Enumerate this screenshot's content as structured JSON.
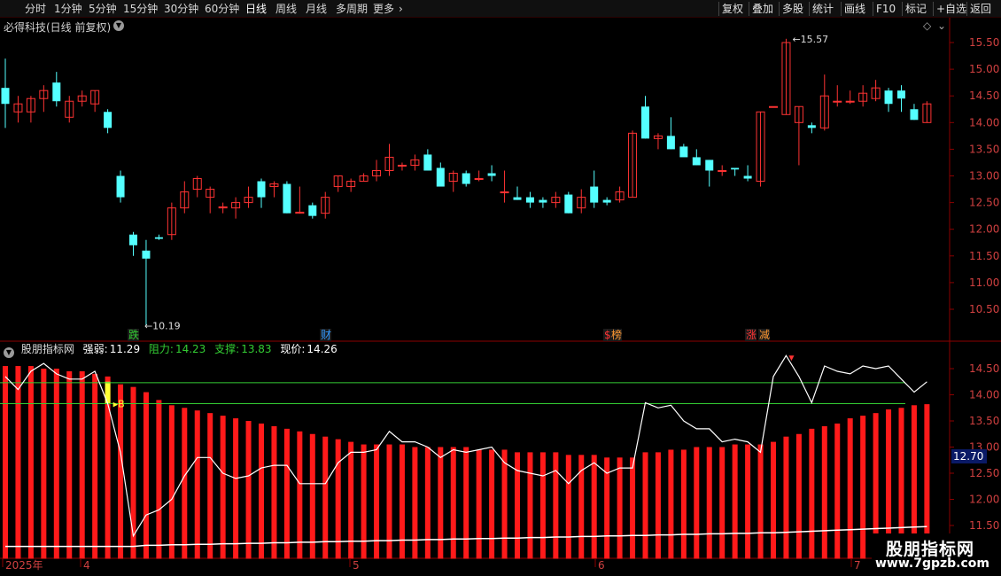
{
  "toolbar": {
    "left_items": [
      "分时",
      "1分钟",
      "5分钟",
      "15分钟",
      "30分钟",
      "60分钟",
      "日线",
      "周线",
      "月线",
      "多周期",
      "更多"
    ],
    "active": "日线",
    "more_arrow": "›",
    "right_items": [
      "复权",
      "叠加",
      "多股",
      "统计",
      "画线",
      "F10",
      "标记",
      "+自选",
      "返回"
    ]
  },
  "main_panel": {
    "title": "必得科技(日线 前复权)",
    "dropdown_icon": "chevron-down-icon",
    "diamond_icon": "diamond-icon",
    "high_label": "15.57",
    "low_label": "10.19",
    "y_ticks": [
      "15.50",
      "15.00",
      "14.50",
      "14.00",
      "13.50",
      "13.00",
      "12.50",
      "12.00",
      "11.50",
      "11.00",
      "10.50"
    ],
    "event_tags": [
      {
        "text": "跌",
        "color": "#33cc33"
      },
      {
        "text": "财",
        "color": "#3399ff"
      },
      {
        "text": "$",
        "color": "#ff3333"
      },
      {
        "text": "榜",
        "color": "#ff9933"
      },
      {
        "text": "涨",
        "color": "#ff3333"
      },
      {
        "text": "减",
        "color": "#ff9933"
      }
    ]
  },
  "indicator_panel": {
    "name": "股朋指标网",
    "strength_label": "强弱:",
    "strength_value": "11.29",
    "resist_label": "阻力:",
    "resist_value": "14.23",
    "support_label": "支撑:",
    "support_value": "13.83",
    "price_label": "现价:",
    "price_value": "14.26",
    "buy_marker": "B",
    "y_ticks": [
      "14.50",
      "14.00",
      "13.50",
      "13.00",
      "12.50",
      "12.00",
      "11.50"
    ],
    "current_price_tag": "12.70"
  },
  "x_axis": {
    "labels": [
      "2025年",
      "4",
      "5",
      "6",
      "7"
    ]
  },
  "watermark": {
    "title": "股朋指标网",
    "url": "www.7gpzb.com"
  },
  "chart_data": {
    "type": "candlestick",
    "columns": [
      "open",
      "high",
      "low",
      "close"
    ],
    "candles": [
      [
        14.65,
        15.2,
        13.9,
        14.35
      ],
      [
        14.2,
        14.5,
        14.0,
        14.35
      ],
      [
        14.2,
        14.5,
        14.0,
        14.45
      ],
      [
        14.45,
        14.7,
        14.2,
        14.6
      ],
      [
        14.75,
        14.95,
        14.3,
        14.4
      ],
      [
        14.1,
        14.5,
        14.0,
        14.4
      ],
      [
        14.4,
        14.6,
        14.3,
        14.5
      ],
      [
        14.35,
        14.6,
        14.2,
        14.6
      ],
      [
        14.2,
        14.25,
        13.8,
        13.9
      ],
      [
        13.0,
        13.1,
        12.5,
        12.6
      ],
      [
        11.9,
        11.95,
        11.5,
        11.7
      ],
      [
        11.6,
        11.8,
        10.2,
        11.45
      ],
      [
        11.85,
        11.9,
        11.8,
        11.82
      ],
      [
        11.9,
        12.5,
        11.8,
        12.4
      ],
      [
        12.4,
        12.9,
        12.3,
        12.7
      ],
      [
        12.75,
        13.0,
        12.6,
        12.95
      ],
      [
        12.6,
        12.8,
        12.3,
        12.75
      ],
      [
        12.4,
        12.5,
        12.3,
        12.42
      ],
      [
        12.4,
        12.6,
        12.2,
        12.5
      ],
      [
        12.5,
        12.8,
        12.4,
        12.6
      ],
      [
        12.9,
        12.95,
        12.4,
        12.6
      ],
      [
        12.8,
        12.9,
        12.6,
        12.85
      ],
      [
        12.85,
        12.9,
        12.3,
        12.3
      ],
      [
        12.3,
        12.8,
        12.3,
        12.32
      ],
      [
        12.45,
        12.5,
        12.2,
        12.25
      ],
      [
        12.3,
        12.7,
        12.2,
        12.6
      ],
      [
        12.8,
        13.0,
        12.7,
        13.0
      ],
      [
        12.8,
        12.95,
        12.7,
        12.9
      ],
      [
        12.9,
        13.05,
        12.9,
        13.0
      ],
      [
        13.0,
        13.3,
        12.9,
        13.1
      ],
      [
        13.1,
        13.6,
        13.0,
        13.35
      ],
      [
        13.2,
        13.25,
        13.1,
        13.2
      ],
      [
        13.2,
        13.4,
        13.1,
        13.3
      ],
      [
        13.4,
        13.5,
        13.1,
        13.1
      ],
      [
        13.15,
        13.25,
        12.9,
        12.8
      ],
      [
        12.9,
        13.1,
        12.7,
        13.05
      ],
      [
        13.05,
        13.1,
        12.8,
        12.85
      ],
      [
        12.95,
        13.1,
        12.9,
        12.95
      ],
      [
        13.05,
        13.2,
        12.9,
        13.0
      ],
      [
        12.7,
        13.1,
        12.5,
        12.7
      ],
      [
        12.6,
        12.8,
        12.55,
        12.55
      ],
      [
        12.6,
        12.7,
        12.4,
        12.5
      ],
      [
        12.55,
        12.6,
        12.4,
        12.5
      ],
      [
        12.5,
        12.7,
        12.4,
        12.6
      ],
      [
        12.65,
        12.7,
        12.3,
        12.3
      ],
      [
        12.4,
        12.75,
        12.3,
        12.6
      ],
      [
        12.8,
        13.1,
        12.4,
        12.5
      ],
      [
        12.55,
        12.6,
        12.45,
        12.5
      ],
      [
        12.55,
        12.8,
        12.5,
        12.7
      ],
      [
        12.6,
        13.85,
        12.6,
        13.8
      ],
      [
        14.3,
        14.5,
        13.7,
        13.7
      ],
      [
        13.7,
        13.8,
        13.5,
        13.75
      ],
      [
        13.75,
        14.1,
        13.5,
        13.5
      ],
      [
        13.55,
        13.6,
        13.4,
        13.35
      ],
      [
        13.35,
        13.5,
        13.2,
        13.2
      ],
      [
        13.3,
        13.3,
        12.8,
        13.1
      ],
      [
        13.1,
        13.2,
        13.0,
        13.1
      ],
      [
        13.15,
        13.15,
        13.0,
        13.12
      ],
      [
        13.0,
        13.2,
        12.9,
        12.95
      ],
      [
        12.9,
        14.2,
        12.8,
        14.2
      ],
      [
        14.3,
        14.3,
        14.3,
        14.3
      ],
      [
        14.15,
        15.57,
        14.15,
        15.5
      ],
      [
        14.0,
        14.3,
        13.2,
        14.3
      ],
      [
        13.95,
        14.0,
        13.8,
        13.9
      ],
      [
        13.9,
        14.9,
        13.85,
        14.5
      ],
      [
        14.4,
        14.7,
        14.3,
        14.4
      ],
      [
        14.4,
        14.6,
        14.35,
        14.4
      ],
      [
        14.4,
        14.7,
        14.3,
        14.55
      ],
      [
        14.45,
        14.8,
        14.4,
        14.65
      ],
      [
        14.6,
        14.65,
        14.2,
        14.35
      ],
      [
        14.6,
        14.7,
        14.2,
        14.45
      ],
      [
        14.25,
        14.35,
        14.05,
        14.05
      ],
      [
        14.0,
        14.4,
        14.0,
        14.35
      ]
    ],
    "ymin": 10.19,
    "ymax": 15.57,
    "strength_line": [
      14.35,
      14.1,
      14.45,
      14.6,
      14.4,
      14.3,
      14.3,
      14.45,
      13.83,
      12.9,
      11.3,
      11.7,
      11.8,
      12.0,
      12.45,
      12.8,
      12.8,
      12.5,
      12.4,
      12.45,
      12.6,
      12.65,
      12.65,
      12.3,
      12.3,
      12.3,
      12.7,
      12.9,
      12.9,
      12.95,
      13.3,
      13.1,
      13.1,
      13.0,
      12.8,
      12.95,
      12.9,
      12.95,
      13.0,
      12.7,
      12.55,
      12.5,
      12.45,
      12.55,
      12.3,
      12.55,
      12.7,
      12.5,
      12.6,
      12.6,
      13.85,
      13.75,
      13.8,
      13.5,
      13.35,
      13.35,
      13.1,
      13.15,
      13.1,
      12.9,
      14.35,
      14.75,
      14.35,
      13.85,
      14.55,
      14.45,
      14.4,
      14.55,
      14.5,
      14.55,
      14.3,
      14.05,
      14.25
    ],
    "bars": [
      14.55,
      14.55,
      14.55,
      14.5,
      14.5,
      14.45,
      14.45,
      14.4,
      14.35,
      14.2,
      14.15,
      14.05,
      13.9,
      13.8,
      13.75,
      13.7,
      13.65,
      13.6,
      13.55,
      13.5,
      13.45,
      13.4,
      13.35,
      13.3,
      13.25,
      13.2,
      13.15,
      13.1,
      13.05,
      13.05,
      13.05,
      13.05,
      13.0,
      13.0,
      13.0,
      13.0,
      13.0,
      12.95,
      12.95,
      12.95,
      12.9,
      12.9,
      12.9,
      12.9,
      12.85,
      12.85,
      12.85,
      12.8,
      12.8,
      12.8,
      12.9,
      12.9,
      12.95,
      12.95,
      13.0,
      13.0,
      13.0,
      13.05,
      13.05,
      13.05,
      13.1,
      13.2,
      13.25,
      13.35,
      13.4,
      13.45,
      13.55,
      13.6,
      13.65,
      13.72,
      13.75,
      13.8,
      13.82
    ],
    "bottom_line": [
      11.1,
      11.1,
      11.1,
      11.1,
      11.1,
      11.1,
      11.1,
      11.1,
      11.1,
      11.1,
      11.1,
      11.12,
      11.12,
      11.13,
      11.13,
      11.14,
      11.14,
      11.15,
      11.15,
      11.16,
      11.16,
      11.17,
      11.17,
      11.18,
      11.18,
      11.19,
      11.19,
      11.2,
      11.2,
      11.21,
      11.21,
      11.22,
      11.22,
      11.23,
      11.23,
      11.24,
      11.24,
      11.25,
      11.25,
      11.26,
      11.26,
      11.27,
      11.27,
      11.28,
      11.28,
      11.29,
      11.29,
      11.3,
      11.3,
      11.31,
      11.31,
      11.32,
      11.32,
      11.33,
      11.33,
      11.34,
      11.34,
      11.35,
      11.35,
      11.36,
      11.36,
      11.37,
      11.38,
      11.39,
      11.4,
      11.41,
      11.42,
      11.43,
      11.44,
      11.45,
      11.46,
      11.47,
      11.48
    ],
    "resistance": 14.23,
    "support": 13.83,
    "ind_ymin": 11.05,
    "ind_ymax": 14.75,
    "colors": {
      "up": "#ff3333",
      "down": "#54ffff",
      "bar": "#ff1a1a",
      "line": "#ffffff",
      "resist": "#33cc33",
      "support": "#33cc33",
      "axis": "#8b0000"
    }
  }
}
